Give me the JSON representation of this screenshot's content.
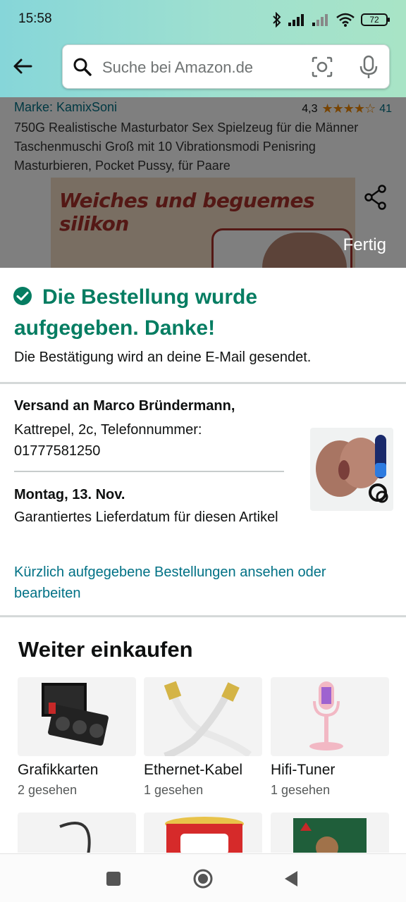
{
  "status_bar": {
    "time": "15:58",
    "battery": "72",
    "icons": [
      "bluetooth-icon",
      "signal-icon",
      "signal-weak-icon",
      "wifi-icon",
      "battery-icon"
    ]
  },
  "header": {
    "back_icon": "arrow-left-icon",
    "search_placeholder": "Suche bei Amazon.de",
    "camera_icon": "camera-scan-icon",
    "mic_icon": "microphone-icon"
  },
  "product": {
    "brand": "Marke: KamixSoni",
    "rating_value": "4,3",
    "rating_stars": 4.3,
    "rating_count": "41",
    "title": "750G Realistische Masturbator Sex Spielzeug für die Männer Taschenmuschi Groß mit 10 Vibrationsmodi Penisring Masturbieren, Pocket Pussy, für Paare",
    "image_banner": "Weiches und beguemes silikon",
    "done_label": "Fertig"
  },
  "confirmation": {
    "heading": "Die Bestellung wurde aufgegeben. Danke!",
    "subtext": "Die Bestätigung wird an deine E-Mail gesendet.",
    "accent": "#067d62"
  },
  "shipping": {
    "recipient": "Versand an Marco Bründermann,",
    "address": "Kattrepel, 2c, Telefonnummer: 01777581250",
    "date": "Montag, 13. Nov.",
    "date_info": "Garantiertes Lieferdatum für diesen Artikel",
    "orders_link": "Kürzlich aufgegebene Bestellungen ansehen oder bearbeiten"
  },
  "continue_shopping": {
    "title": "Weiter einkaufen",
    "items": [
      {
        "label": "Grafikkarten",
        "meta": "2 gesehen"
      },
      {
        "label": "Ethernet-Kabel",
        "meta": "1 gesehen"
      },
      {
        "label": "Hifi-Tuner",
        "meta": "1 gesehen"
      }
    ]
  },
  "colors": {
    "link": "#007185",
    "star": "#f08804",
    "success": "#067d62"
  }
}
